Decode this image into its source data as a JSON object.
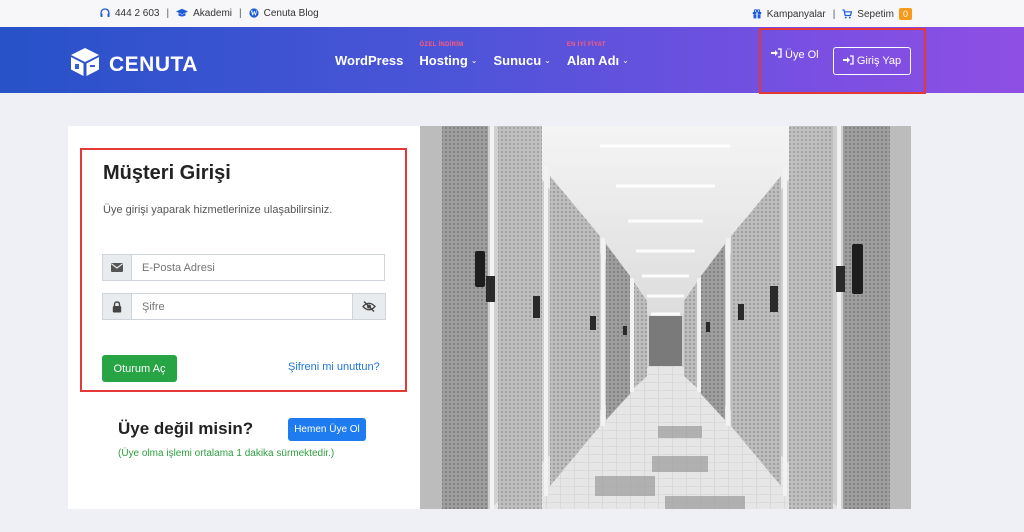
{
  "topbar": {
    "phone": "444 2 603",
    "academy": "Akademi",
    "blog": "Cenuta Blog",
    "campaigns": "Kampanyalar",
    "cart": "Sepetim",
    "cart_count": "0",
    "separator": "|"
  },
  "header": {
    "logo_text": "CENUTA",
    "nav": [
      {
        "label": "WordPress",
        "tag": ""
      },
      {
        "label": "Hosting",
        "tag": "ÖZEL İNDİRİM"
      },
      {
        "label": "Sunucu",
        "tag": ""
      },
      {
        "label": "Alan Adı",
        "tag": "EN İYİ FİYAT"
      }
    ],
    "register_label": "Üye Ol",
    "login_label": "Giriş Yap"
  },
  "login": {
    "title": "Müşteri Girişi",
    "subtitle": "Üye girişi yaparak hizmetlerinize ulaşabilirsiniz.",
    "email_placeholder": "E-Posta Adresi",
    "password_placeholder": "Şifre",
    "submit_label": "Oturum Aç",
    "forgot_label": "Şifreni mi unuttun?"
  },
  "signup": {
    "question": "Üye değil misin?",
    "button_label": "Hemen Üye Ol",
    "note": "(Üye olma işlemi ortalama 1 dakika sürmektedir.)"
  },
  "colors": {
    "header_start": "#2752c8",
    "header_end": "#8f4fe4",
    "submit_green": "#27a544",
    "link_blue": "#1e73d8",
    "highlight_red": "#e53935"
  }
}
